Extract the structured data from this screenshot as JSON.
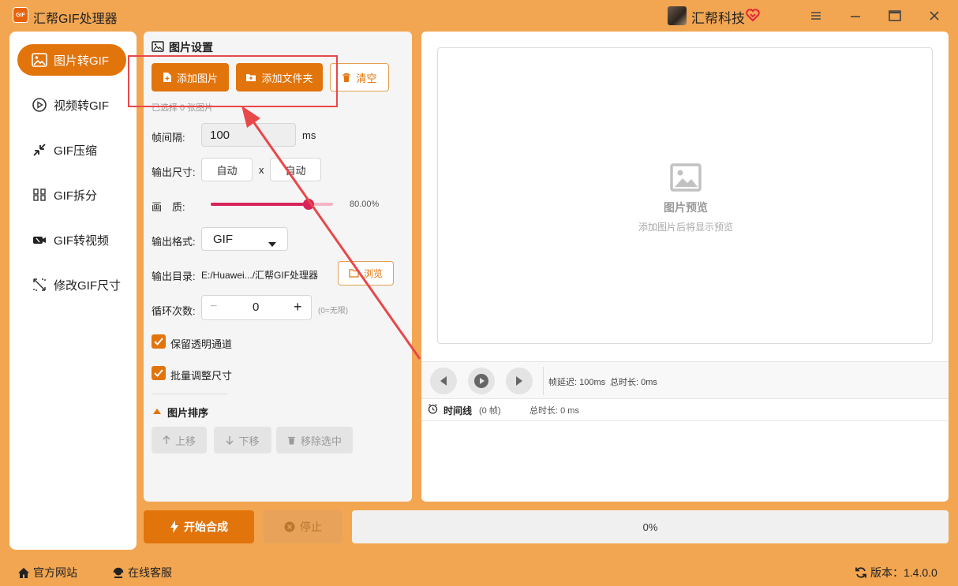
{
  "window": {
    "title": "汇帮GIF处理器",
    "logo_text": "GIF",
    "brand": "汇帮科技"
  },
  "sidebar": {
    "items": [
      {
        "label": "图片转GIF",
        "icon": "image-icon",
        "active": true
      },
      {
        "label": "视频转GIF",
        "icon": "play-circle-icon",
        "active": false
      },
      {
        "label": "GIF压缩",
        "icon": "compress-icon",
        "active": false
      },
      {
        "label": "GIF拆分",
        "icon": "split-icon",
        "active": false
      },
      {
        "label": "GIF转视频",
        "icon": "video-icon",
        "active": false
      },
      {
        "label": "修改GIF尺寸",
        "icon": "resize-icon",
        "active": false
      }
    ]
  },
  "settings": {
    "title": "图片设置",
    "add_images": "添加图片",
    "add_folder": "添加文件夹",
    "clear": "清空",
    "selected_count": "已选择 0 张图片",
    "frame_interval_label": "帧间隔:",
    "frame_interval_value": "100",
    "frame_interval_unit": "ms",
    "output_size_label": "输出尺寸:",
    "width_value": "自动",
    "size_sep": "x",
    "height_value": "自动",
    "quality_label": "画　质:",
    "quality_value": "80.00%",
    "quality_fraction": 0.8,
    "format_label": "输出格式:",
    "format_value": "GIF",
    "output_dir_label": "输出目录:",
    "output_dir_value": "E:/Huawei.../汇帮GIF处理器",
    "browse": "浏览",
    "loop_label": "循环次数:",
    "loop_minus": "−",
    "loop_value": "0",
    "loop_plus": "+",
    "loop_hint": "(0=无限)",
    "keep_alpha": "保留透明通道",
    "batch_resize": "批量调整尺寸",
    "sort_title": "图片排序",
    "move_up": "上移",
    "move_down": "下移",
    "remove_selected": "移除选中"
  },
  "preview": {
    "title": "图片预览",
    "subtitle": "添加图片后将显示预览",
    "frame_delay": "帧延迟: 100ms",
    "total_duration": "总时长: 0ms",
    "timeline_label": "时间线",
    "timeline_frames": "(0 帧)",
    "timeline_total": "总时长: 0 ms"
  },
  "actions": {
    "start": "开始合成",
    "stop": "停止",
    "progress_text": "0%",
    "progress_fraction": 0
  },
  "footer": {
    "website": "官方网站",
    "support": "在线客服",
    "version": "版本：1.4.0.0"
  },
  "colors": {
    "accent": "#e2740c",
    "window_bg": "#f2a651",
    "annotation": "#e8484a"
  }
}
